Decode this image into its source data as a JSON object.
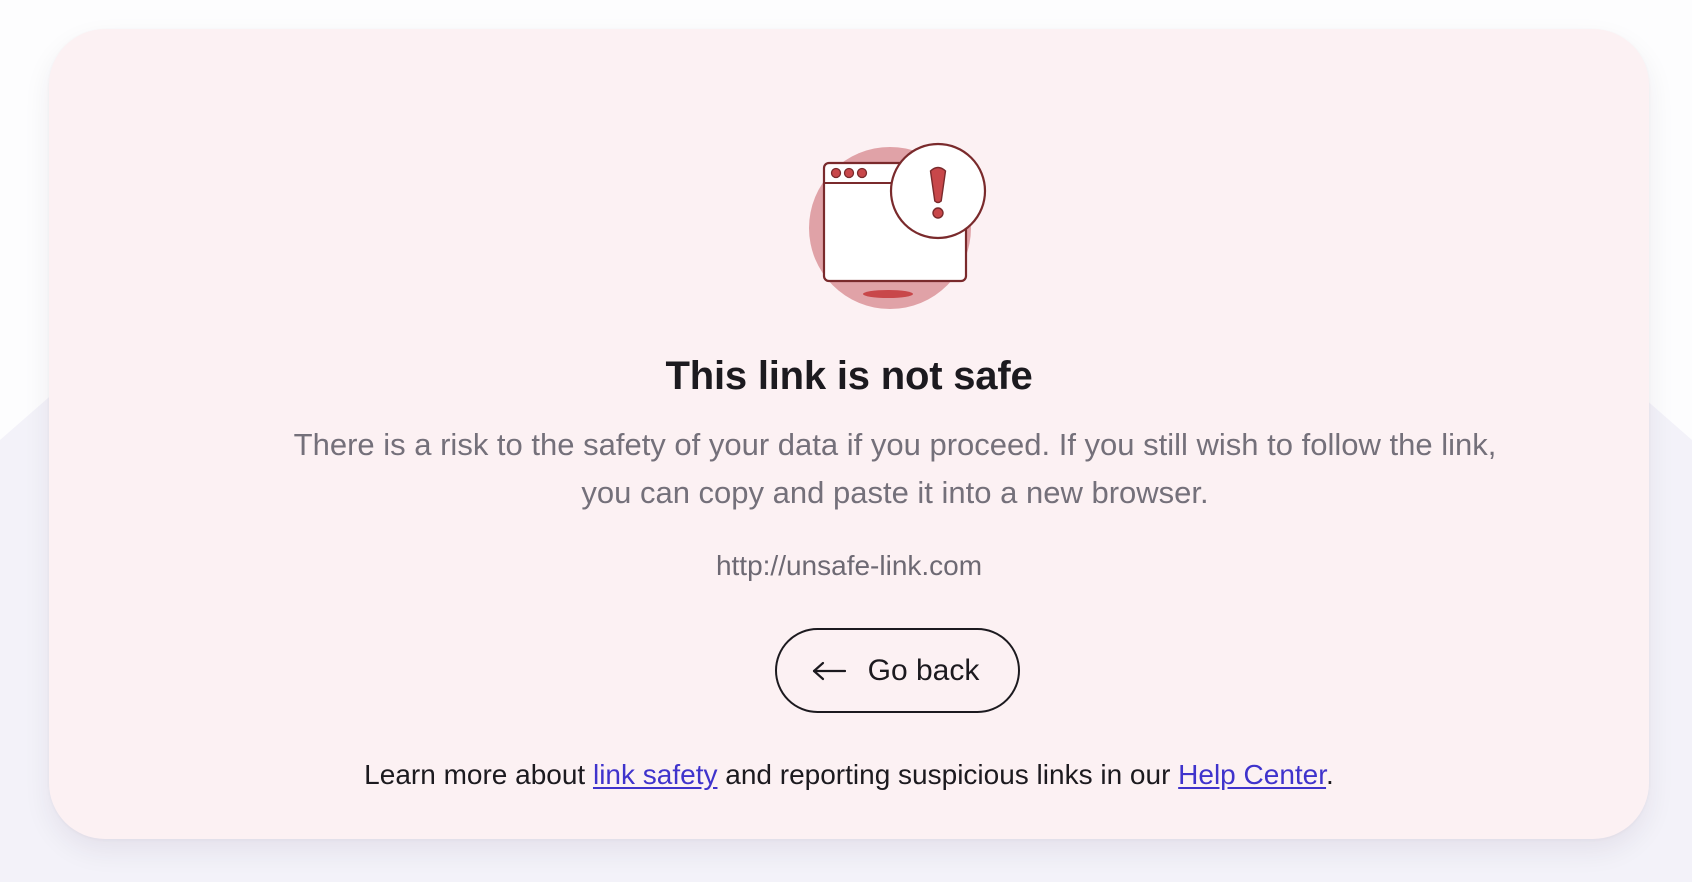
{
  "page": {
    "background_color": "#f8f7fb",
    "card_color": "#fcf1f3"
  },
  "illustration": {
    "icon": "unsafe-browser-window-warning",
    "accent_color": "#c8474a",
    "circle_color": "#e0a2a7",
    "stroke_color": "#7a2a2c"
  },
  "warning": {
    "title": "This link is not safe",
    "description_line1": "There is a risk to the safety of your data if you proceed. If you still wish to follow the link,",
    "description_line2": "you can copy and paste it into a new browser.",
    "url": "http://unsafe-link.com"
  },
  "actions": {
    "back_label": "Go back",
    "back_icon": "arrow-left-icon"
  },
  "footer": {
    "prefix": "Learn more about ",
    "link1_label": "link safety",
    "middle": " and reporting suspicious links in our ",
    "link2_label": "Help Center",
    "suffix": ".",
    "link_color": "#3f33cc"
  }
}
